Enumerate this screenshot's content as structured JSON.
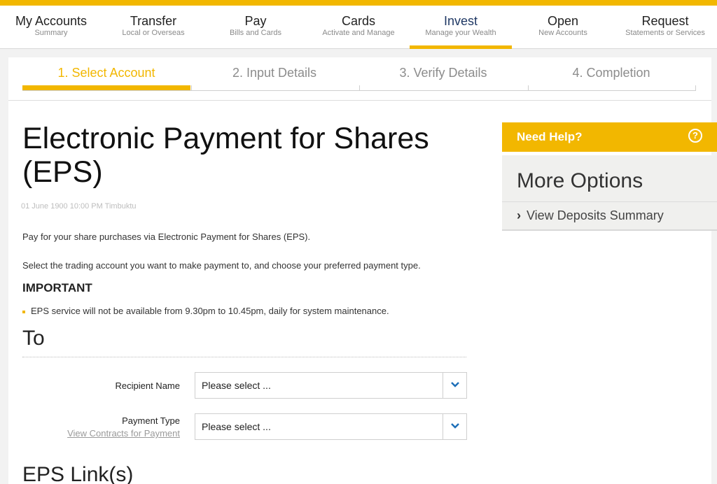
{
  "nav": {
    "items": [
      {
        "title": "My Accounts",
        "sub": "Summary"
      },
      {
        "title": "Transfer",
        "sub": "Local or Overseas"
      },
      {
        "title": "Pay",
        "sub": "Bills and Cards"
      },
      {
        "title": "Cards",
        "sub": "Activate and Manage"
      },
      {
        "title": "Invest",
        "sub": "Manage your Wealth"
      },
      {
        "title": "Open",
        "sub": "New Accounts"
      },
      {
        "title": "Request",
        "sub": "Statements or Services"
      }
    ],
    "active_index": 4
  },
  "steps": [
    "1. Select Account",
    "2. Input Details",
    "3. Verify Details",
    "4. Completion"
  ],
  "page": {
    "title": "Electronic Payment for Shares (EPS)",
    "datetime": "01 June 1900 10:00 PM Timbuktu",
    "intro1": "Pay for your share purchases via Electronic Payment for Shares (EPS).",
    "intro2": "Select the trading account you want to make payment to, and choose your preferred payment type.",
    "important_heading": "IMPORTANT",
    "important_note": "EPS service will not be available from 9.30pm to 10.45pm, daily for system maintenance."
  },
  "to_section": {
    "heading": "To",
    "recipient_label": "Recipient Name",
    "recipient_value": "Please select ...",
    "payment_type_label": "Payment Type",
    "payment_type_link": "View Contracts for Payment",
    "payment_type_value": "Please select ..."
  },
  "links_section": {
    "heading": "EPS Link(s)"
  },
  "sidebar": {
    "help_label": "Need Help?",
    "help_icon": "question-icon",
    "more_title": "More Options",
    "more_link": "View Deposits Summary"
  },
  "colors": {
    "accent": "#f2b700",
    "active_nav": "#1f3864"
  }
}
